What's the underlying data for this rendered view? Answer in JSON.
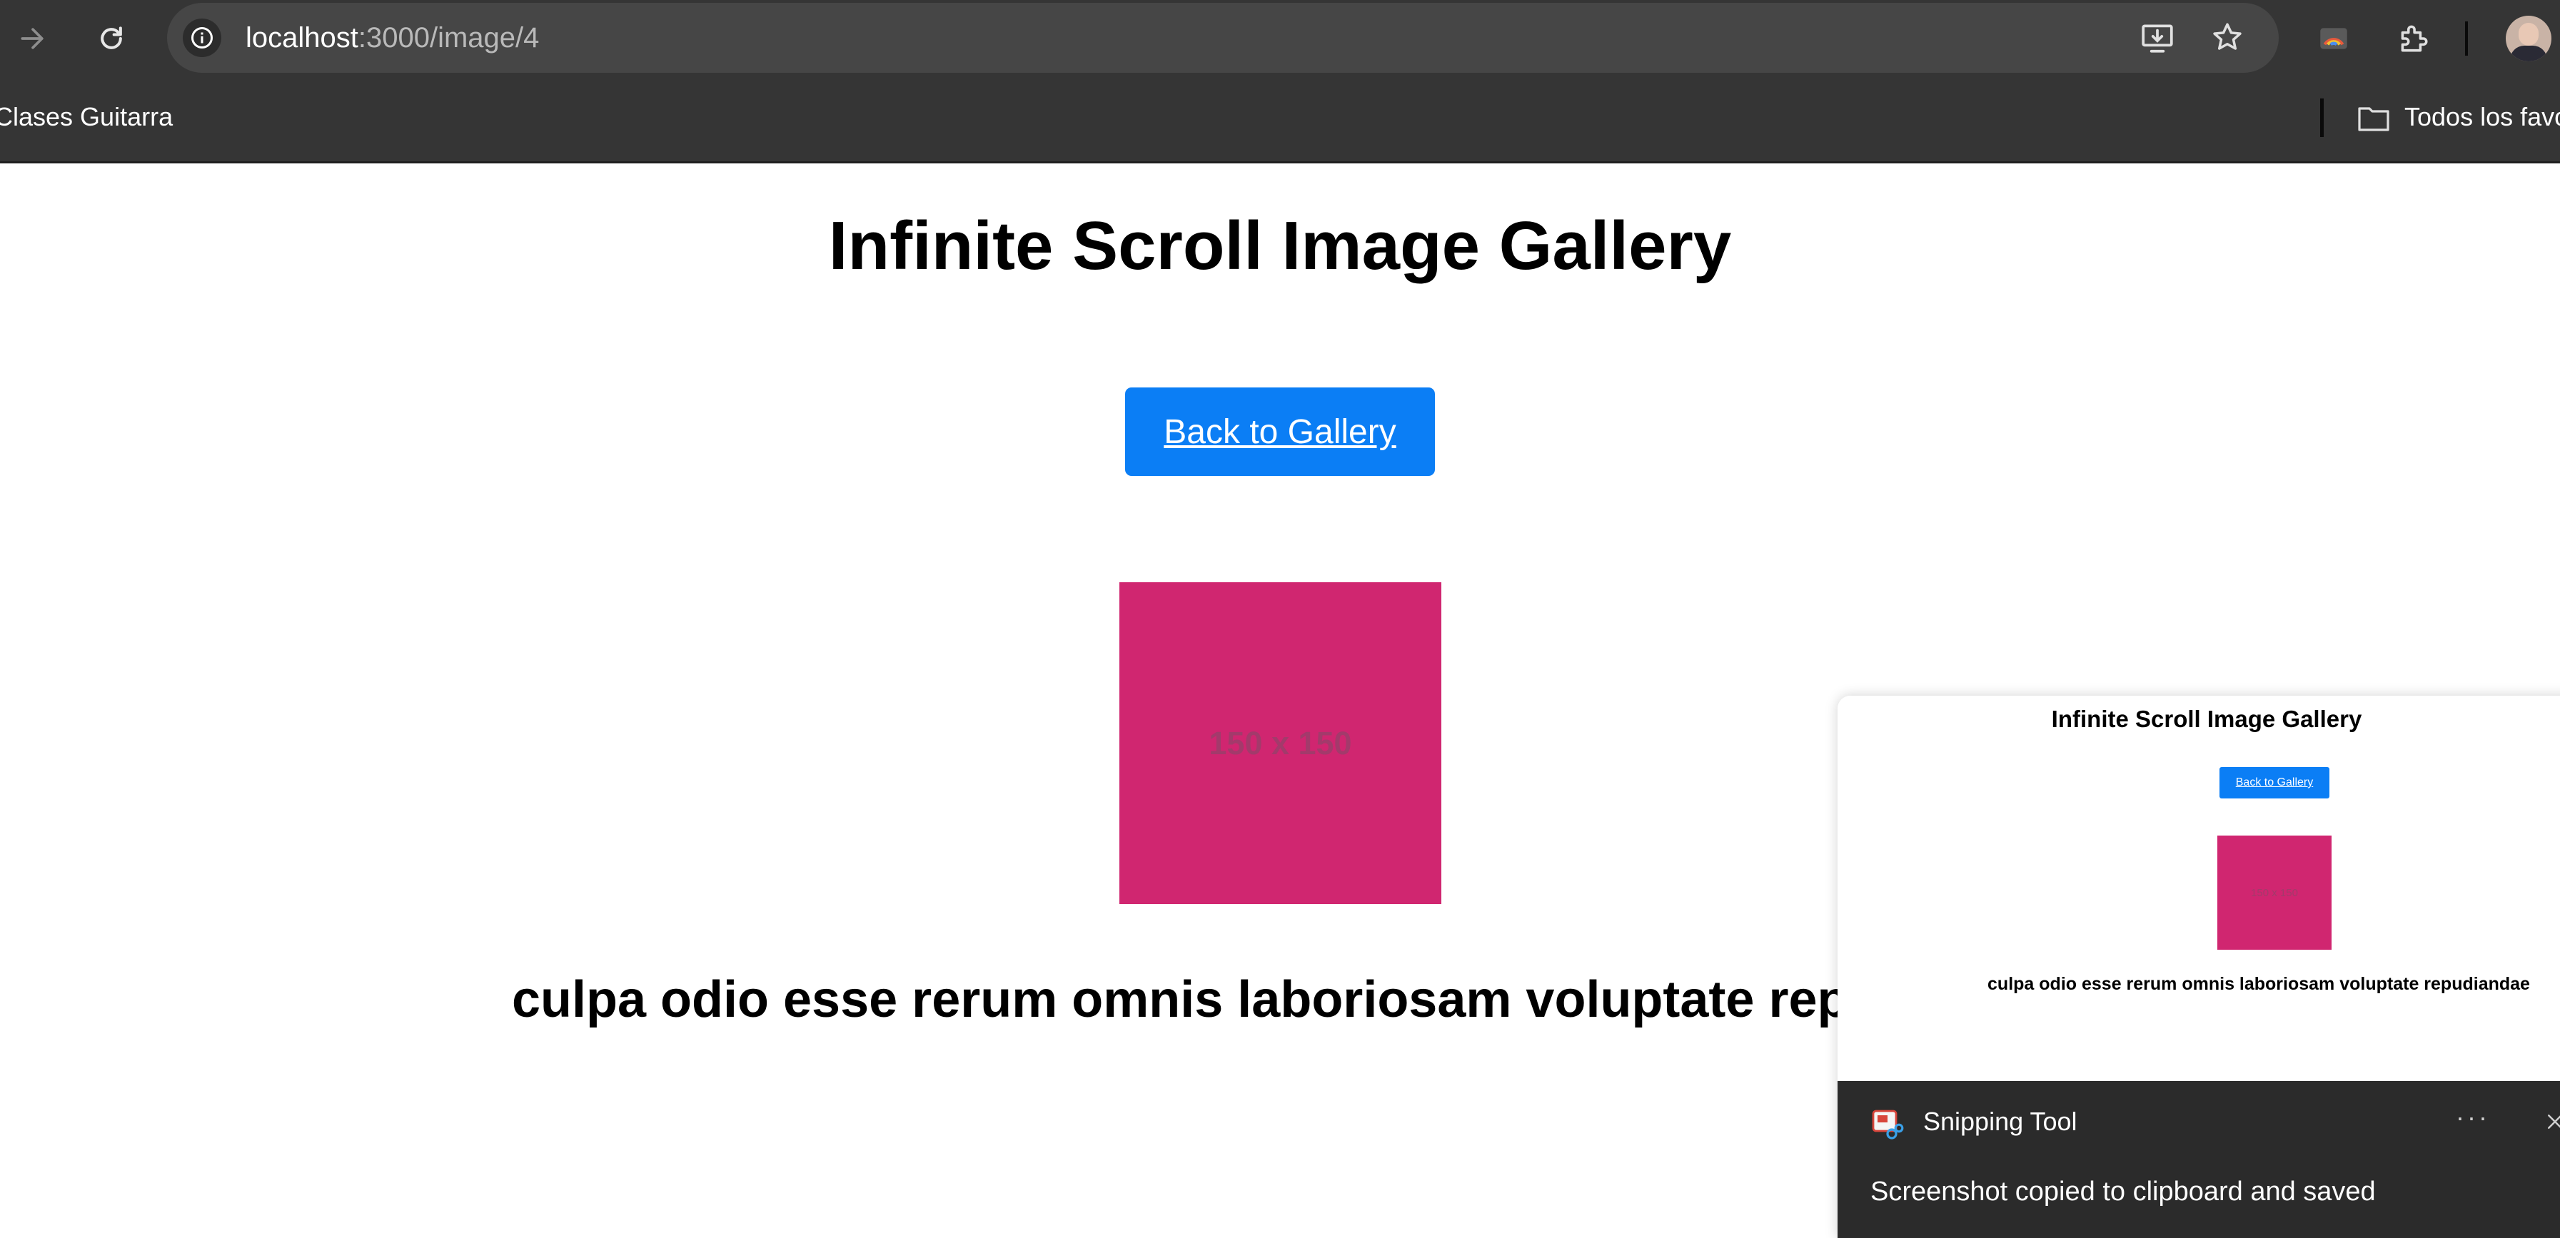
{
  "browser": {
    "url_host": "localhost",
    "url_path": ":3000/image/4",
    "bookmarks": {
      "left_label": "Clases Guitarra",
      "folder_label": "Todos los favo"
    },
    "icons": [
      "forward-icon",
      "reload-icon",
      "site-info-icon",
      "install-app-icon",
      "bookmark-star-icon",
      "cast-icon",
      "extensions-icon",
      "profile-avatar",
      "folder-icon"
    ]
  },
  "page": {
    "title": "Infinite Scroll Image Gallery",
    "back_button": "Back to Gallery",
    "image_placeholder": "150 x 150",
    "image_color": "#d02670",
    "caption": "culpa odio esse rerum omnis laboriosam voluptate repudiandae"
  },
  "snipping_tool": {
    "preview": {
      "title": "Infinite Scroll Image Gallery",
      "back_button": "Back to Gallery",
      "image_placeholder": "150 x 150",
      "caption": "culpa odio esse rerum omnis laboriosam voluptate repudiandae"
    },
    "app_name": "Snipping Tool",
    "more_label": "···",
    "message": "Screenshot copied to clipboard and saved"
  },
  "colors": {
    "chrome_bg": "#353535",
    "omnibox_bg": "#464646",
    "button_blue": "#0b7ef5",
    "toast_bg": "#2b2b2b"
  }
}
